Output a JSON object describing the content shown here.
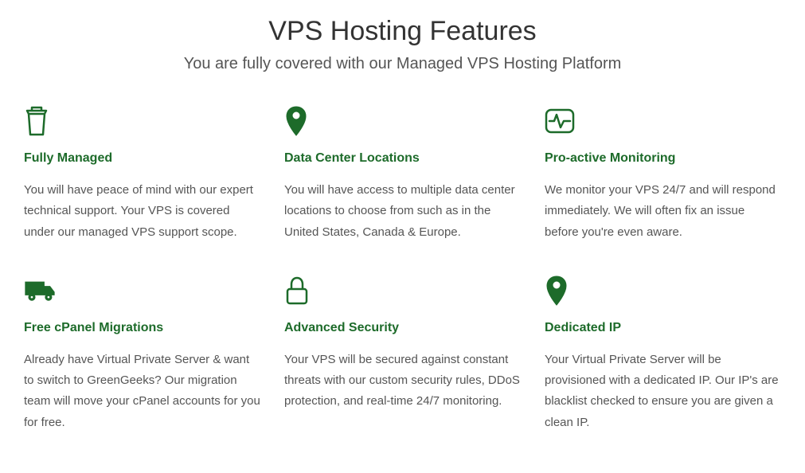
{
  "header": {
    "title": "VPS Hosting Features",
    "subtitle": "You are fully covered with our Managed VPS Hosting Platform"
  },
  "features": [
    {
      "title": "Fully Managed",
      "desc": "You will have peace of mind with our expert technical support. Your VPS is covered under our managed VPS support scope."
    },
    {
      "title": "Data Center Locations",
      "desc": "You will have access to multiple data center locations to choose from such as in the United States, Canada & Europe."
    },
    {
      "title": "Pro-active Monitoring",
      "desc": "We monitor your VPS 24/7 and will respond immediately. We will often fix an issue before you're even aware."
    },
    {
      "title": "Free cPanel Migrations",
      "desc": "Already have Virtual Private Server & want to switch to GreenGeeks? Our migration team will move your cPanel accounts for you for free."
    },
    {
      "title": "Advanced Security",
      "desc": "Your VPS will be secured against constant threats with our custom security rules, DDoS protection, and real-time 24/7 monitoring."
    },
    {
      "title": "Dedicated IP",
      "desc": "Your Virtual Private Server will be provisioned with a dedicated IP. Our IP's are blacklist checked to ensure you are given a clean IP."
    }
  ]
}
